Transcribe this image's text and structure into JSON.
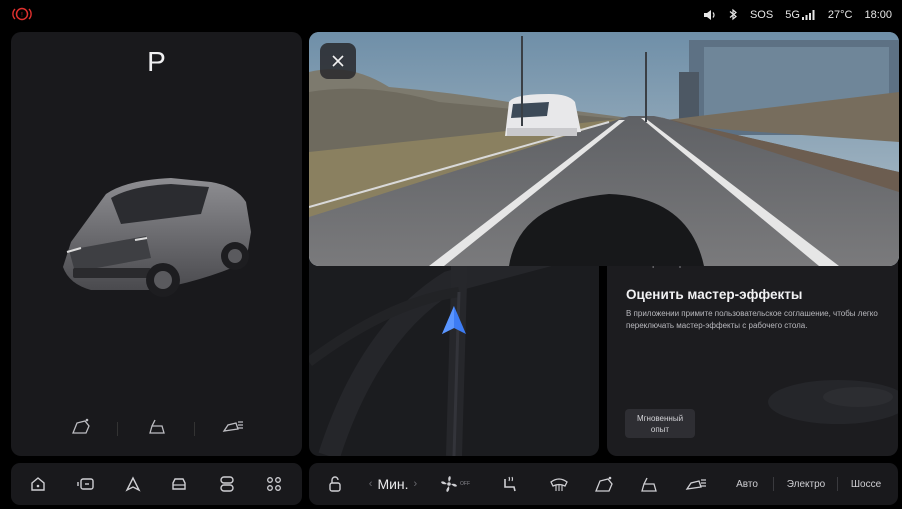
{
  "status_bar": {
    "alert_icon": "hazard-ring-icon",
    "sos": "SOS",
    "network": "5G",
    "temperature": "27°C",
    "time": "18:00",
    "accent_red": "#e0302e"
  },
  "car_panel": {
    "gear": "P",
    "actions": [
      "charge-port-icon",
      "trunk-icon",
      "headlight-icon"
    ]
  },
  "camera_popup": {
    "close_icon": "close-icon"
  },
  "map": {
    "nav_arrow_color": "#3d7cf4"
  },
  "effects_card": {
    "subtitle": "Мастер-покер",
    "title": "Оценить мастер-эффекты",
    "description": "В приложении примите пользовательское соглашение, чтобы легко переключать мастер-эффекты с рабочего стола.",
    "button_line1": "Мгновенный",
    "button_line2": "опыт"
  },
  "dock_left": {
    "items": [
      "home-icon",
      "media-icon",
      "navigation-icon",
      "car-icon",
      "apps-stack-icon",
      "apps-grid-icon"
    ]
  },
  "dock_right": {
    "lock_icon": "lock-icon",
    "fan_level": "Мин.",
    "fan_icon": "fan-icon",
    "fan_off": "OFF",
    "modes": [
      "Авто",
      "Электро",
      "Шоссе"
    ]
  }
}
